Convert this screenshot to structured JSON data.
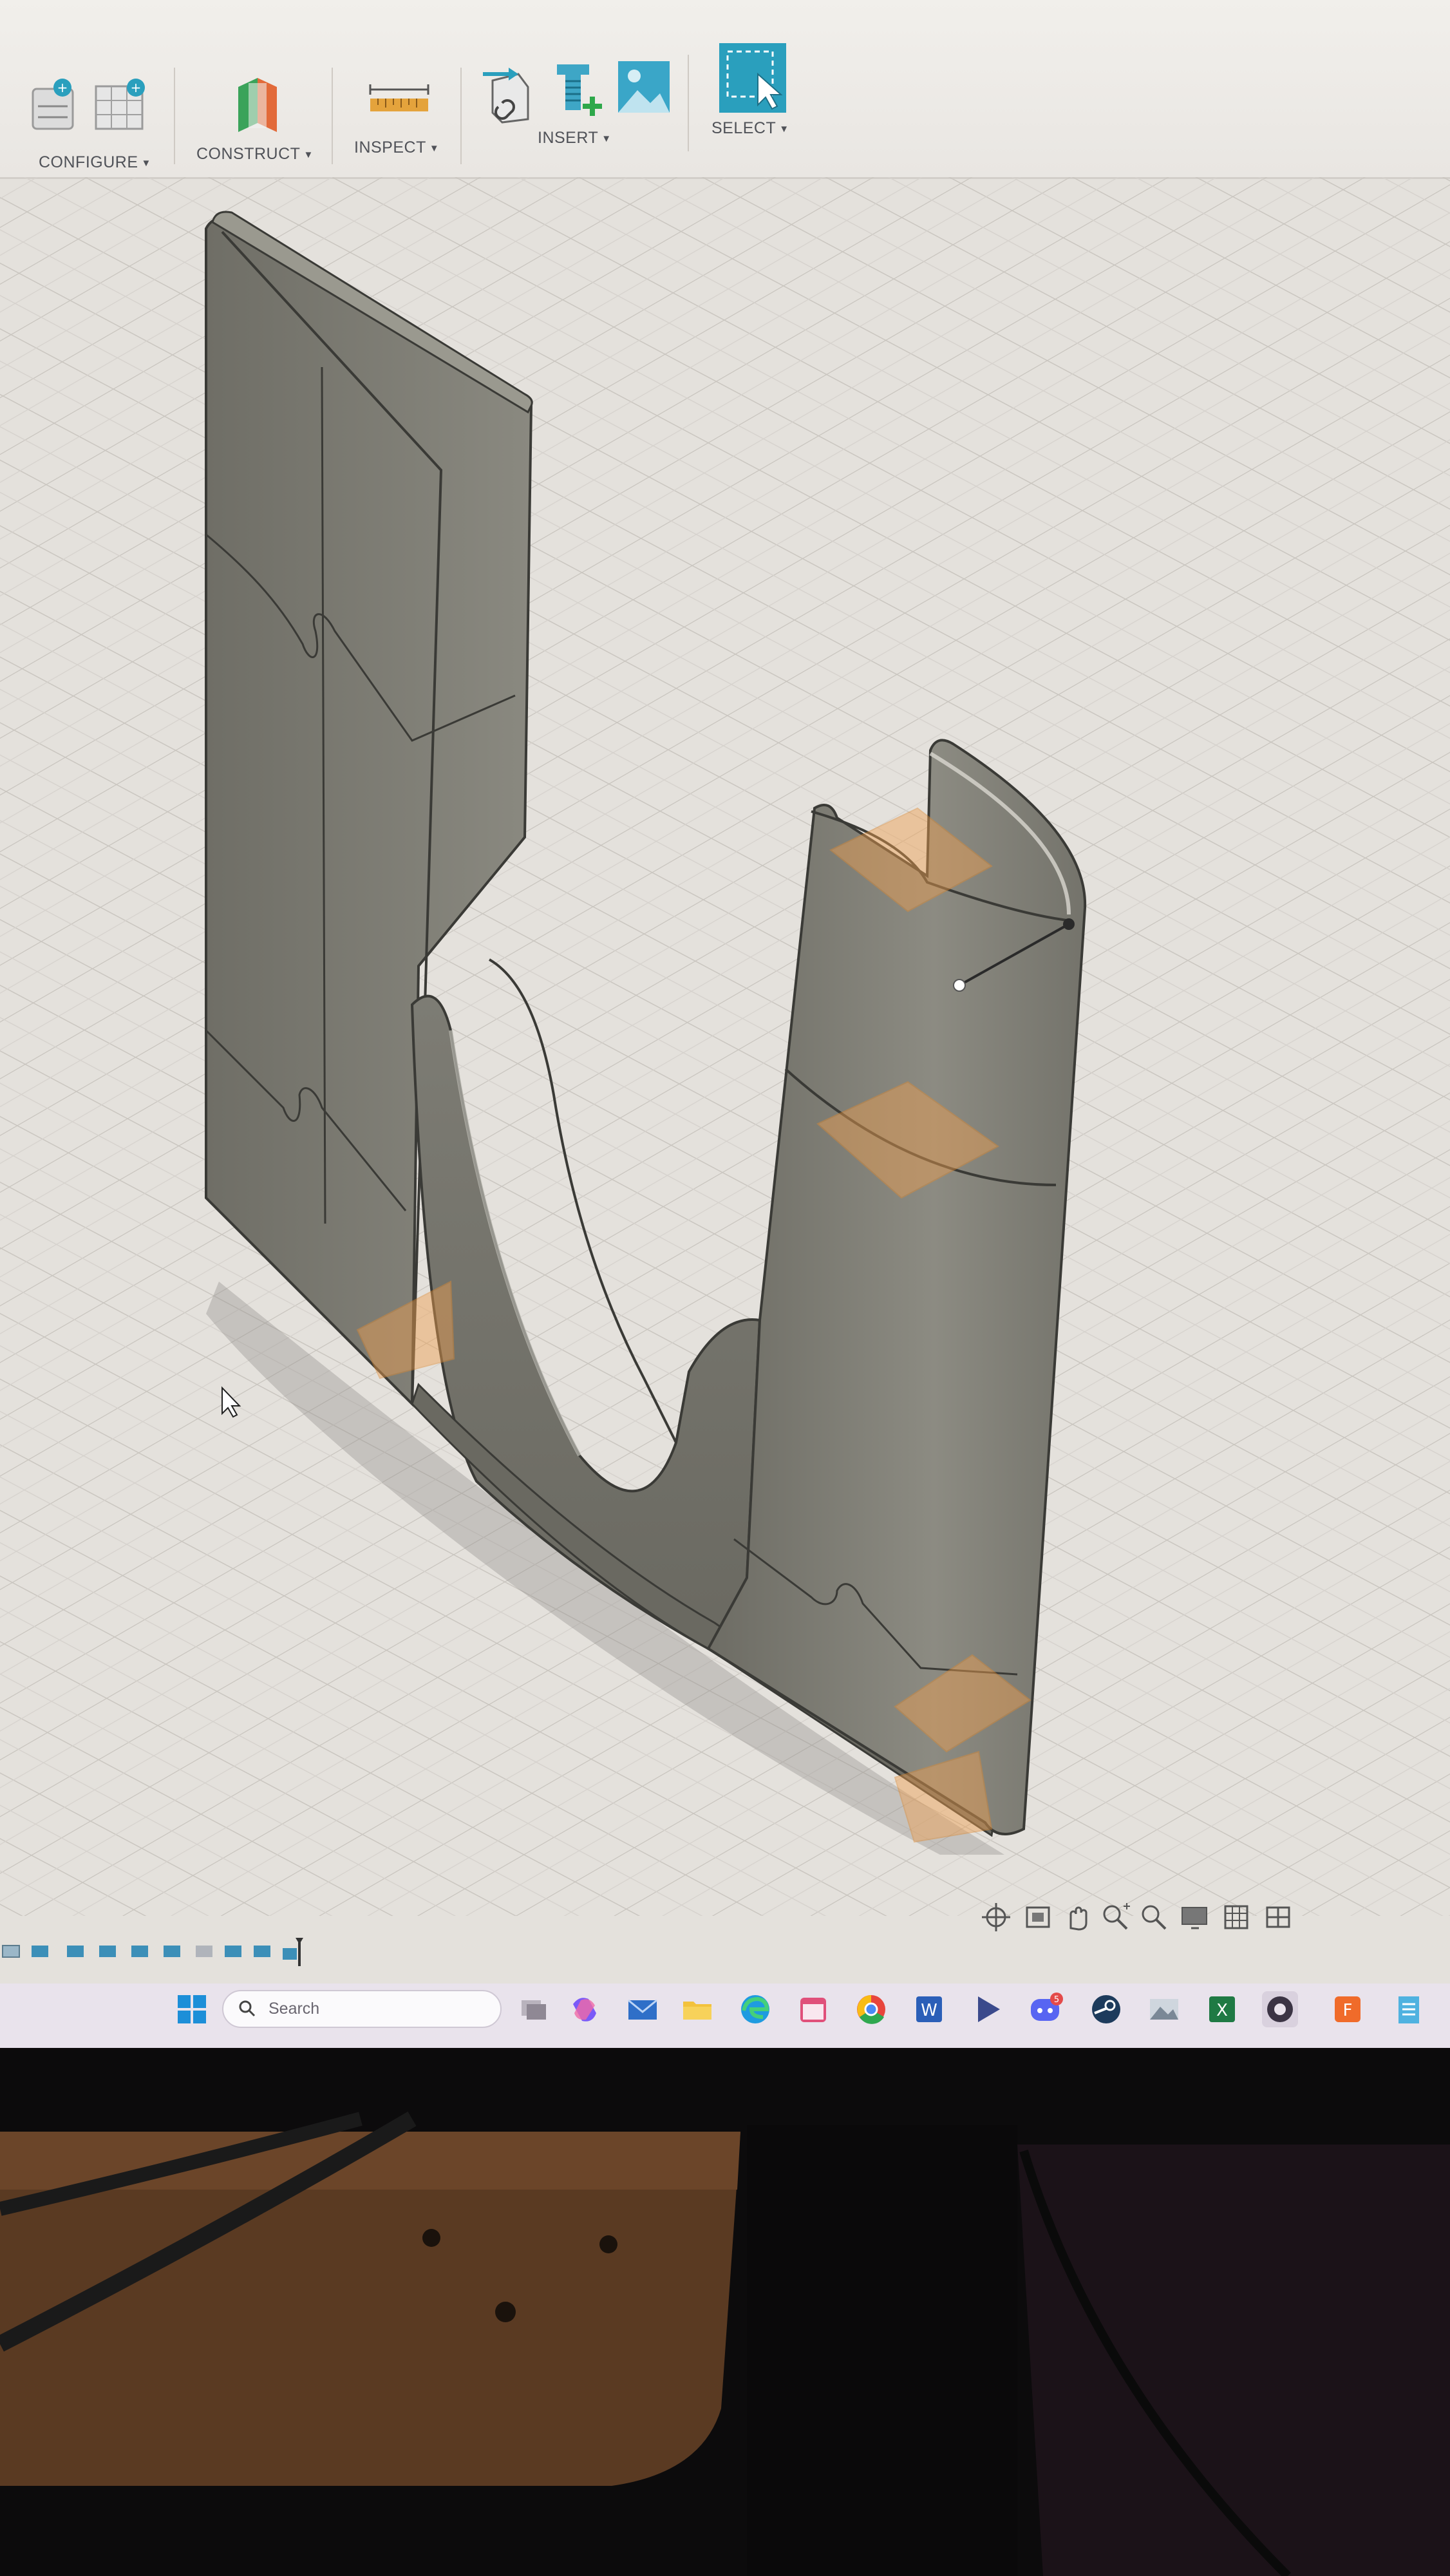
{
  "toolbar": {
    "groups": [
      {
        "label": "CONFIGURE",
        "icons": [
          "configure-icon",
          "parameters-icon"
        ]
      },
      {
        "label": "CONSTRUCT",
        "icons": [
          "construct-plane-icon"
        ]
      },
      {
        "label": "INSPECT",
        "icons": [
          "measure-icon"
        ]
      },
      {
        "label": "INSERT",
        "icons": [
          "insert-derive-icon",
          "insert-mcmaster-icon",
          "insert-canvas-icon"
        ]
      },
      {
        "label": "SELECT",
        "icons": [
          "select-icon"
        ]
      }
    ]
  },
  "taskbar": {
    "search_placeholder": "Search",
    "icons": [
      "windows-start-icon",
      "task-view-icon",
      "copilot-icon",
      "mail-icon",
      "file-explorer-icon",
      "edge-icon",
      "calendar-icon",
      "chrome-icon",
      "word-icon",
      "media-player-icon",
      "discord-icon",
      "steam-icon",
      "photos-icon",
      "excel-icon",
      "obs-icon",
      "fusion-icon",
      "notepad-icon"
    ],
    "notification_badge": "5"
  },
  "colors": {
    "accent": "#2a9fbd",
    "model_body": "#7b7a72",
    "highlight": "#f0a050",
    "canvas": "#e4e1dc"
  }
}
